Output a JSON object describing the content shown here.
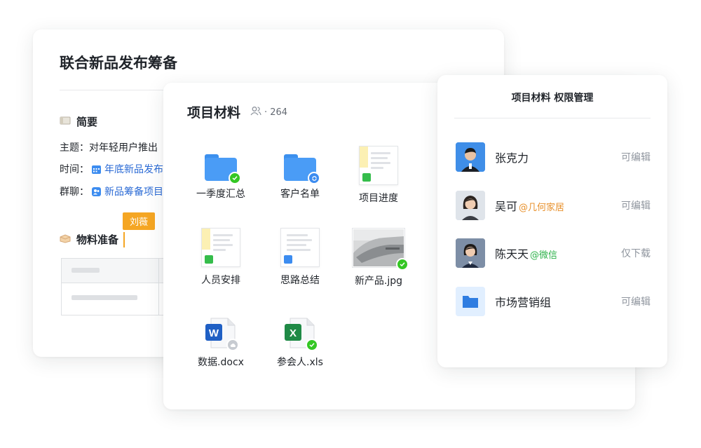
{
  "doc": {
    "title": "联合新品发布筹备",
    "summary_heading": "简要",
    "topic_label": "主题：",
    "topic_value": "对年轻用户推出",
    "time_label": "时间：",
    "time_link": "年底新品发布",
    "group_label": "群聊：",
    "group_link": "新品筹备项目",
    "materials_heading": "物料准备",
    "cursor_user": "刘薇"
  },
  "files": {
    "title": "项目材料",
    "member_count": "· 264",
    "items": [
      {
        "name": "一季度汇总",
        "type": "folder",
        "badge": "check"
      },
      {
        "name": "客户名单",
        "type": "folder",
        "badge": "sync"
      },
      {
        "name": "项目进度",
        "type": "sheet"
      },
      {
        "name": "人员安排",
        "type": "sheet"
      },
      {
        "name": "思路总结",
        "type": "doc"
      },
      {
        "name": "新产品.jpg",
        "type": "image",
        "badge": "check"
      },
      {
        "name": "数据.docx",
        "type": "word",
        "badge": "cloud"
      },
      {
        "name": "参会人.xls",
        "type": "excel",
        "badge": "check"
      }
    ]
  },
  "permissions": {
    "title": "项目材料 权限管理",
    "rows": [
      {
        "name": "张克力",
        "tag": "",
        "role": "可编辑"
      },
      {
        "name": "吴可",
        "tag": "@几何家居",
        "role": "可编辑"
      },
      {
        "name": "陈天天",
        "tag": "@微信",
        "role": "仅下载"
      },
      {
        "name": "市场营销组",
        "tag": "",
        "role": "可编辑"
      }
    ]
  },
  "colors": {
    "accent_blue": "#2a6ad5",
    "folder_blue": "#4a9cf6",
    "success_green": "#34c724",
    "cursor_orange": "#f5a623",
    "tag_orange": "#e8912c",
    "tag_green": "#2db24a"
  },
  "icons": [
    "calendar-icon",
    "group-chat-icon",
    "members-icon",
    "note-icon",
    "box-icon",
    "check-badge-icon",
    "sync-badge-icon",
    "cloud-badge-icon",
    "word-icon",
    "excel-icon",
    "folder-icon"
  ]
}
